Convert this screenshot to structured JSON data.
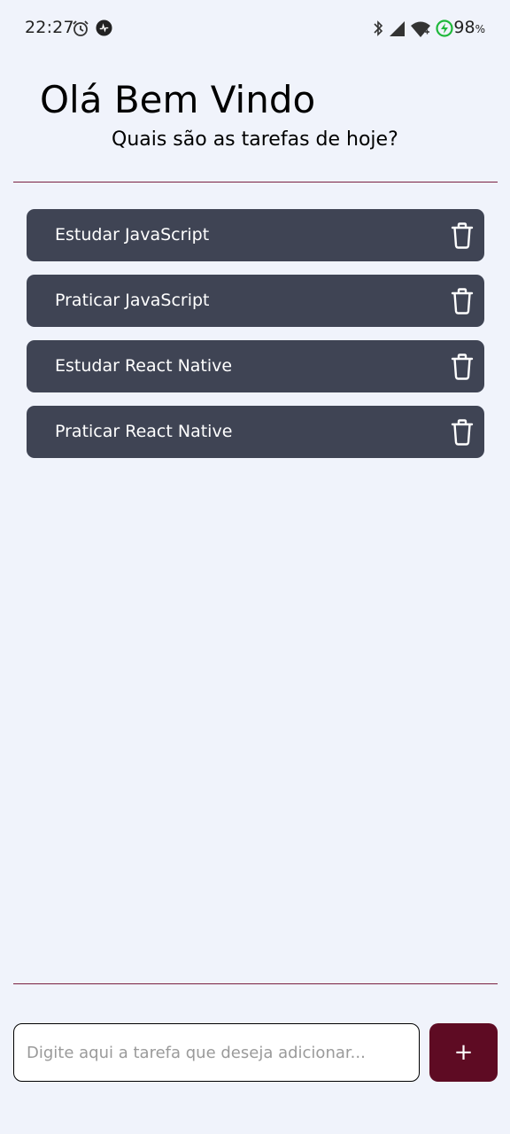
{
  "status_bar": {
    "time": "22:27",
    "battery_level": "98",
    "battery_unit": "%",
    "icons": [
      "alarm-icon",
      "app-notification-icon",
      "bluetooth-icon",
      "signal-icon",
      "wifi-icon",
      "battery-charging-icon"
    ]
  },
  "header": {
    "greeting": "Olá Bem Vindo",
    "subtitle": "Quais são as tarefas de hoje?"
  },
  "tasks": [
    {
      "label": "Estudar JavaScript",
      "action_icon": "trash-icon"
    },
    {
      "label": "Praticar JavaScript",
      "action_icon": "trash-icon"
    },
    {
      "label": "Estudar React Native",
      "action_icon": "trash-icon"
    },
    {
      "label": "Praticar React Native",
      "action_icon": "trash-icon"
    }
  ],
  "composer": {
    "input_value": "",
    "input_placeholder": "Digite aqui a tarefa que deseja adicionar...",
    "add_label": "+"
  },
  "colors": {
    "background": "#f0f3fb",
    "task_background": "#3f4454",
    "task_text": "#ffffff",
    "accent": "#5e0b23",
    "divider": "#7a2040"
  }
}
